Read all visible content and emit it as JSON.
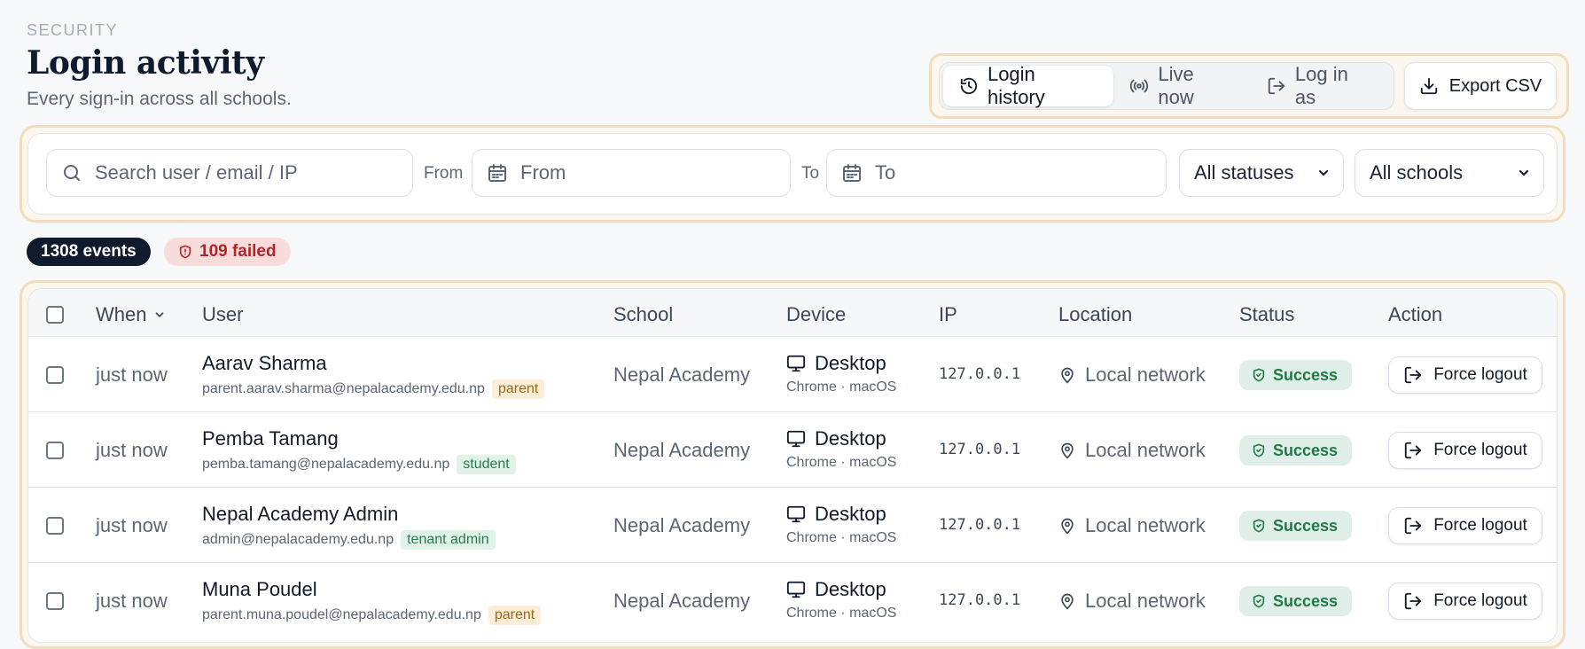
{
  "header": {
    "eyebrow": "SECURITY",
    "title": "Login activity",
    "subtitle": "Every sign-in across all schools."
  },
  "tabs": [
    {
      "label": "Login history",
      "icon": "history-icon",
      "active": true
    },
    {
      "label": "Live now",
      "icon": "broadcast-icon",
      "active": false
    },
    {
      "label": "Log in as",
      "icon": "login-as-icon",
      "active": false
    }
  ],
  "export": {
    "label": "Export CSV",
    "icon": "download-icon"
  },
  "filters": {
    "search_placeholder": "Search user / email / IP",
    "from_label": "From",
    "from_placeholder": "From",
    "to_label": "To",
    "to_placeholder": "To",
    "status_value": "All statuses",
    "school_value": "All schools"
  },
  "summary": {
    "events": "1308 events",
    "failed": "109 failed"
  },
  "table": {
    "columns": {
      "when": "When",
      "user": "User",
      "school": "School",
      "device": "Device",
      "ip": "IP",
      "location": "Location",
      "status": "Status",
      "action": "Action"
    },
    "rows": [
      {
        "when": "just now",
        "name": "Aarav Sharma",
        "email": "parent.aarav.sharma@nepalacademy.edu.np",
        "role": "parent",
        "school": "Nepal Academy",
        "device": "Desktop",
        "device_detail": "Chrome · macOS",
        "ip": "127.0.0.1",
        "location": "Local network",
        "status": "Success",
        "action": "Force logout"
      },
      {
        "when": "just now",
        "name": "Pemba Tamang",
        "email": "pemba.tamang@nepalacademy.edu.np",
        "role": "student",
        "school": "Nepal Academy",
        "device": "Desktop",
        "device_detail": "Chrome · macOS",
        "ip": "127.0.0.1",
        "location": "Local network",
        "status": "Success",
        "action": "Force logout"
      },
      {
        "when": "just now",
        "name": "Nepal Academy Admin",
        "email": "admin@nepalacademy.edu.np",
        "role": "tenant admin",
        "school": "Nepal Academy",
        "device": "Desktop",
        "device_detail": "Chrome · macOS",
        "ip": "127.0.0.1",
        "location": "Local network",
        "status": "Success",
        "action": "Force logout"
      },
      {
        "when": "just now",
        "name": "Muna Poudel",
        "email": "parent.muna.poudel@nepalacademy.edu.np",
        "role": "parent",
        "school": "Nepal Academy",
        "device": "Desktop",
        "device_detail": "Chrome · macOS",
        "ip": "127.0.0.1",
        "location": "Local network",
        "status": "Success",
        "action": "Force logout"
      }
    ]
  },
  "colors": {
    "highlight_border": "#f1ddbd",
    "events_badge": "#0f1b2d",
    "failed_badge_bg": "#f8dcdc",
    "failed_badge_text": "#b4232a",
    "success_bg": "#dfeee6",
    "success_text": "#1f7a48"
  }
}
